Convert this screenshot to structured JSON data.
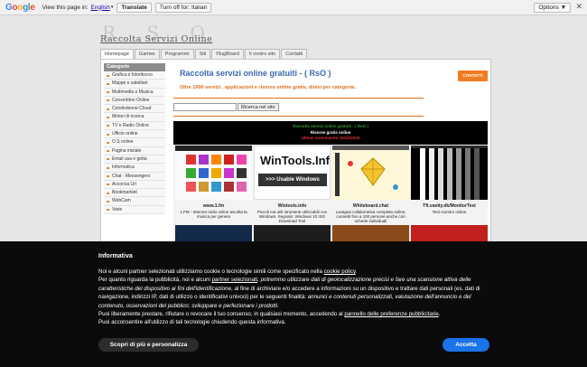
{
  "gbar": {
    "logo": [
      "G",
      "o",
      "o",
      "g",
      "l",
      "e"
    ],
    "view_text": "View this page in:",
    "language": "English",
    "translate_btn": "Translate",
    "turn_off_btn": "Turn off for: Italian",
    "options_btn": "Options ▼",
    "close": "✕"
  },
  "site": {
    "logo_big": "R S O",
    "logo_small": "Raccolta Servizi Online",
    "nav": [
      "Homepage",
      "Games",
      "Programmi",
      "Siti",
      "PlugBoard",
      "Il vostro sito",
      "Contatti"
    ],
    "sidebar_head": "Categorie",
    "sidebar": [
      "Grafica e fotoritocco",
      "Mappe e satelitari",
      "Multimedia e Musica",
      "Convertitori Online",
      "Condivisione-Cloud",
      "Motori di ricerca",
      "TV e Radio Online",
      "Ufficio online",
      "O.S online",
      "Pagina iniziale",
      "Email usa e getta",
      "Informatica",
      "Chat - Messengers",
      "Accorcia Url",
      "Bookmarklet",
      "WebCam",
      "Varie"
    ],
    "title": "Raccolta servizi online gratuiti - ( RsO )",
    "contact_btn": "CONTATTI",
    "subtitle": "Oltre 1000 servizi , applicazioni e risorse online gratis, divisi per categoria.",
    "search_btn": "Ricerca nel sito",
    "box_head": {
      "line1": "Raccolta servizi online gratuiti - ( RsO )",
      "line2": "Risorse gratis online",
      "line3": "Ultimo inserimento 15/12/2020"
    },
    "tiles": [
      {
        "title": "www.1.fm",
        "desc": "1.FM - Internet radio online ascolta la musica per genere"
      },
      {
        "title": "Wintools.info",
        "desc": "Piccoli ma utili strumenti utilizzabili con Windows. Segnalo: Windows 10 ISO Download Tool"
      },
      {
        "title": "Whiteboard.chat",
        "desc": "Lavagna collaborativa completa online, connetti fino a 100 persone anche con schede individuali"
      },
      {
        "title": "Tft.vanity.dk/MonitorTest",
        "desc": "Test monitor online"
      }
    ],
    "wintools_thumb": {
      "line1": "WinTools.Info",
      "line2": ">>> Usable Windows Tools"
    }
  },
  "cookie": {
    "title": "Informativa",
    "p1_pre": "Noi e alcuni partner selezionati utilizziamo cookie o tecnologie simili come specificato nella ",
    "p1_link": "cookie policy",
    "p2_pre": "Per quanto riguarda la pubblicità, noi e alcuni ",
    "p2_link": "partner selezionati",
    "p2_mid": ", potremmo utilizzare dati di geolocalizzazione precisi e fare una scansione attiva delle caratteristiche del dispositivo ai fini dell'identificazione",
    "p2_rest": ", al fine di archiviare e/o accedere a informazioni su un dispositivo e trattare dati personali (es. dati di navigazione, indirizzi IP, dati di utilizzo o identificativi univoci) per le seguenti finalità: ",
    "p2_ital": "annunci e contenuti personalizzati, valutazione dell'annuncio e del contenuto, osservazioni del pubblico; sviluppare e perfezionare i prodotti.",
    "p3_pre": "Puoi liberamente prestare, rifiutare o revocare il tuo consenso, in qualsiasi momento, accedendo al ",
    "p3_link": "pannello delle preferenze pubblicitarie",
    "p4": "Puoi acconsentire all'utilizzo di tali tecnologie chiudendo questa informativa.",
    "btn_more": "Scopri di più e personalizza",
    "btn_accept": "Accetta"
  }
}
